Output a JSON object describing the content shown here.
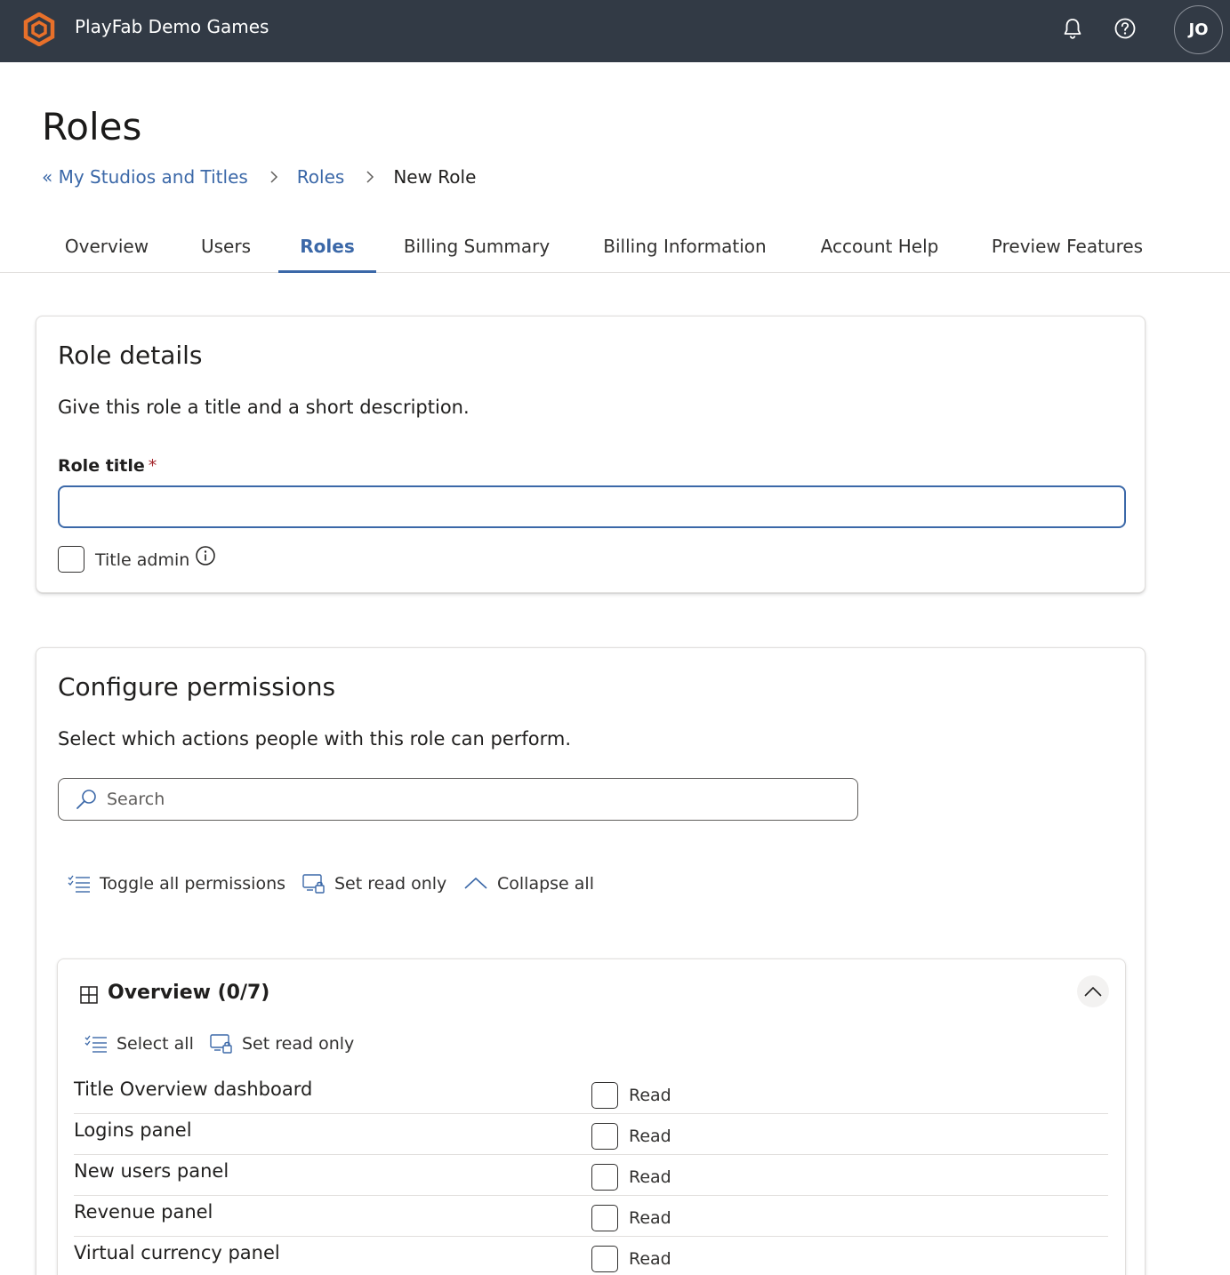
{
  "header": {
    "app_title": "PlayFab Demo Games",
    "avatar_initials": "JO",
    "icons": [
      "playfab-logo",
      "bell-icon",
      "help-icon"
    ]
  },
  "page": {
    "title": "Roles",
    "breadcrumb": [
      "« My Studios and Titles",
      "Roles",
      "New Role"
    ]
  },
  "tabs": [
    "Overview",
    "Users",
    "Roles",
    "Billing Summary",
    "Billing Information",
    "Account Help",
    "Preview Features"
  ],
  "active_tab": "Roles",
  "role_details": {
    "heading": "Role details",
    "description": "Give this role a title and a short description.",
    "role_title_label": "Role title",
    "required_mark": "*",
    "role_title_value": "",
    "title_admin_label": "Title admin",
    "title_admin_checked": false
  },
  "permissions": {
    "heading": "Configure permissions",
    "description": "Select which actions people with this role can perform.",
    "search_placeholder": "Search",
    "actions": [
      "Toggle all permissions",
      "Set read only",
      "Collapse all"
    ],
    "group": {
      "title": "Overview (0/7)",
      "select_all": "Select all",
      "set_read_only": "Set read only",
      "rows": [
        {
          "name": "Title Overview dashboard",
          "access": "Read",
          "checked": false
        },
        {
          "name": "Logins panel",
          "access": "Read",
          "checked": false
        },
        {
          "name": "New users panel",
          "access": "Read",
          "checked": false
        },
        {
          "name": "Revenue panel",
          "access": "Read",
          "checked": false
        },
        {
          "name": "Virtual currency panel",
          "access": "Read",
          "checked": false
        }
      ]
    }
  },
  "colors": {
    "topbar": "#323a45",
    "accent": "#3b68a8",
    "logo": "#e8702a",
    "required": "#a4262c"
  }
}
